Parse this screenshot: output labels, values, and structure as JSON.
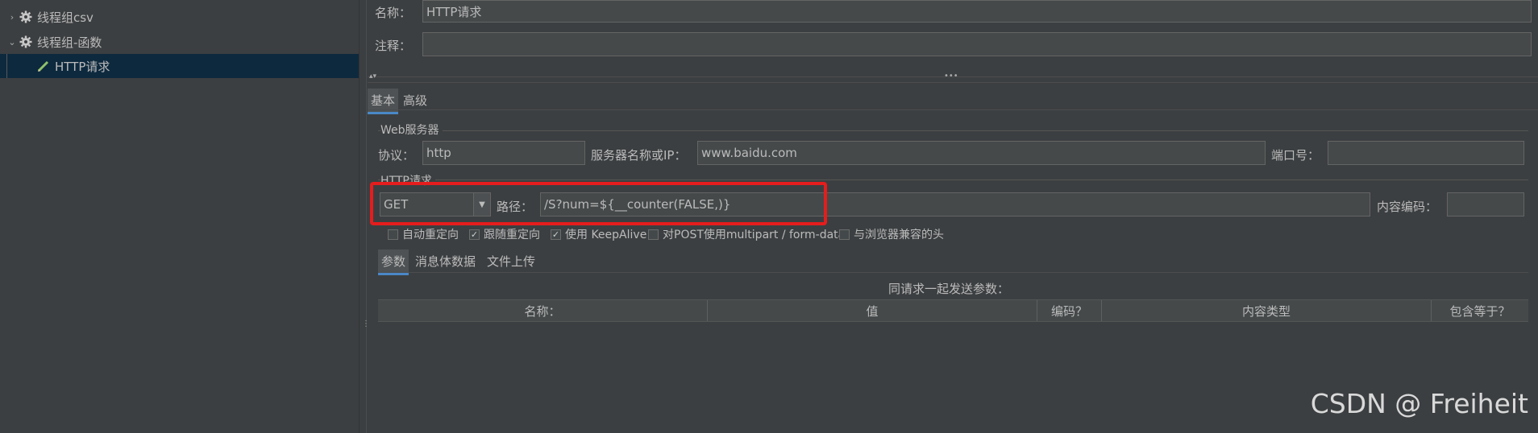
{
  "tree": {
    "items": [
      {
        "label": "线程组csv",
        "expanded": false,
        "icon": "gear-icon"
      },
      {
        "label": "线程组-函数",
        "expanded": true,
        "icon": "gear-icon"
      },
      {
        "label": "HTTP请求",
        "icon": "pencil-icon",
        "selected": true
      }
    ]
  },
  "form": {
    "name_label": "名称：",
    "name_value": "HTTP请求",
    "comment_label": "注释：",
    "comment_value": ""
  },
  "tabs": {
    "main": [
      "基本",
      "高级"
    ],
    "sub": [
      "参数",
      "消息体数据",
      "文件上传"
    ]
  },
  "web_server": {
    "group_title": "Web服务器",
    "protocol_label": "协议：",
    "protocol_value": "http",
    "server_label": "服务器名称或IP：",
    "server_value": "www.baidu.com",
    "port_label": "端口号：",
    "port_value": ""
  },
  "http_request": {
    "group_title": "HTTP请求",
    "method_value": "GET",
    "path_label": "路径：",
    "path_value": "/S?num=${__counter(FALSE,)}",
    "encoding_label": "内容编码：",
    "encoding_value": ""
  },
  "checkboxes": [
    {
      "label": "自动重定向",
      "checked": false
    },
    {
      "label": "跟随重定向",
      "checked": true
    },
    {
      "label": "使用 KeepAlive",
      "checked": true
    },
    {
      "label": "对POST使用multipart / form-data",
      "checked": false
    },
    {
      "label": "与浏览器兼容的头",
      "checked": false
    }
  ],
  "params": {
    "caption": "同请求一起发送参数：",
    "columns": [
      "名称：",
      "值",
      "编码？",
      "内容类型",
      "包含等于？"
    ]
  },
  "watermark": "CSDN @ Freiheit",
  "colors": {
    "background": "#3c3f41",
    "selected_row": "#0d293e",
    "highlight_box": "#e51d1d",
    "tab_underline": "#4a88c7"
  }
}
